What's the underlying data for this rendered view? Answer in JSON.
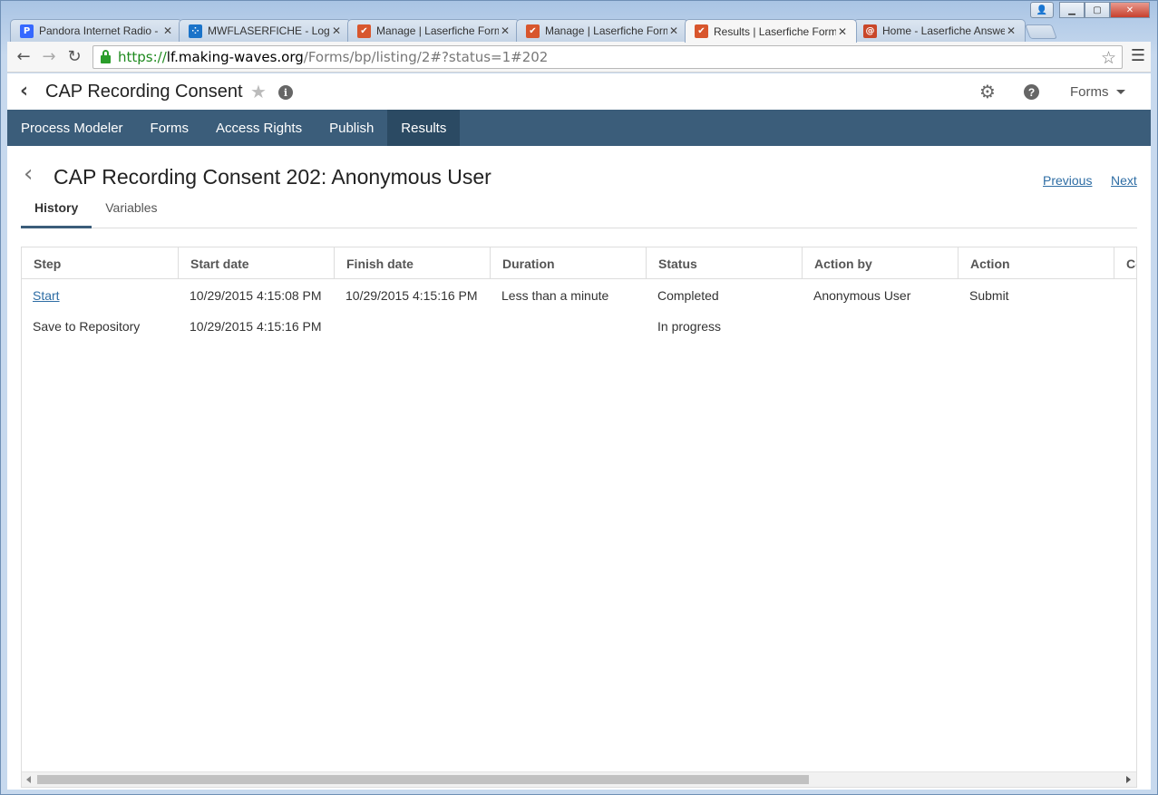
{
  "browser": {
    "tabs": [
      {
        "title": "Pandora Internet Radio - ",
        "icon": "pandora-icon",
        "icon_glyph": "P",
        "icon_color": "#ffffff",
        "active": false
      },
      {
        "title": "MWFLASERFICHE - LogM",
        "icon": "logmein-icon",
        "icon_glyph": "⁘",
        "icon_color": "#1a73c9",
        "active": false
      },
      {
        "title": "Manage | Laserfiche Form",
        "icon": "laserfiche-forms-icon",
        "icon_glyph": "✔",
        "icon_color": "#d8562d",
        "active": false
      },
      {
        "title": "Manage | Laserfiche Form",
        "icon": "laserfiche-forms-icon",
        "icon_glyph": "✔",
        "icon_color": "#d8562d",
        "active": false
      },
      {
        "title": "Results | Laserfiche Form",
        "icon": "laserfiche-forms-icon",
        "icon_glyph": "✔",
        "icon_color": "#d8562d",
        "active": true
      },
      {
        "title": "Home - Laserfiche Answe",
        "icon": "laserfiche-answers-icon",
        "icon_glyph": "@",
        "icon_color": "#c9472a",
        "active": false
      }
    ],
    "url": {
      "scheme": "https://",
      "host": "lf.making-waves.org",
      "path": "/Forms/bp/listing/2#?status=1#202"
    }
  },
  "app": {
    "title": "CAP Recording Consent",
    "forms_menu_label": "Forms",
    "nav": [
      {
        "label": "Process Modeler",
        "active": false
      },
      {
        "label": "Forms",
        "active": false
      },
      {
        "label": "Access Rights",
        "active": false
      },
      {
        "label": "Publish",
        "active": false
      },
      {
        "label": "Results",
        "active": true
      }
    ]
  },
  "detail": {
    "title": "CAP Recording Consent 202: Anonymous User",
    "previous_label": "Previous",
    "next_label": "Next",
    "tabs": [
      {
        "label": "History",
        "active": true
      },
      {
        "label": "Variables",
        "active": false
      }
    ]
  },
  "history_table": {
    "columns": [
      "Step",
      "Start date",
      "Finish date",
      "Duration",
      "Status",
      "Action by",
      "Action",
      "Co"
    ],
    "rows": [
      [
        "Start",
        "10/29/2015 4:15:08 PM",
        "10/29/2015 4:15:16 PM",
        "Less than a minute",
        "Completed",
        "Anonymous User",
        "Submit",
        ""
      ],
      [
        "Save to Repository",
        "10/29/2015 4:15:16 PM",
        "",
        "",
        "In progress",
        "",
        "",
        ""
      ]
    ]
  }
}
